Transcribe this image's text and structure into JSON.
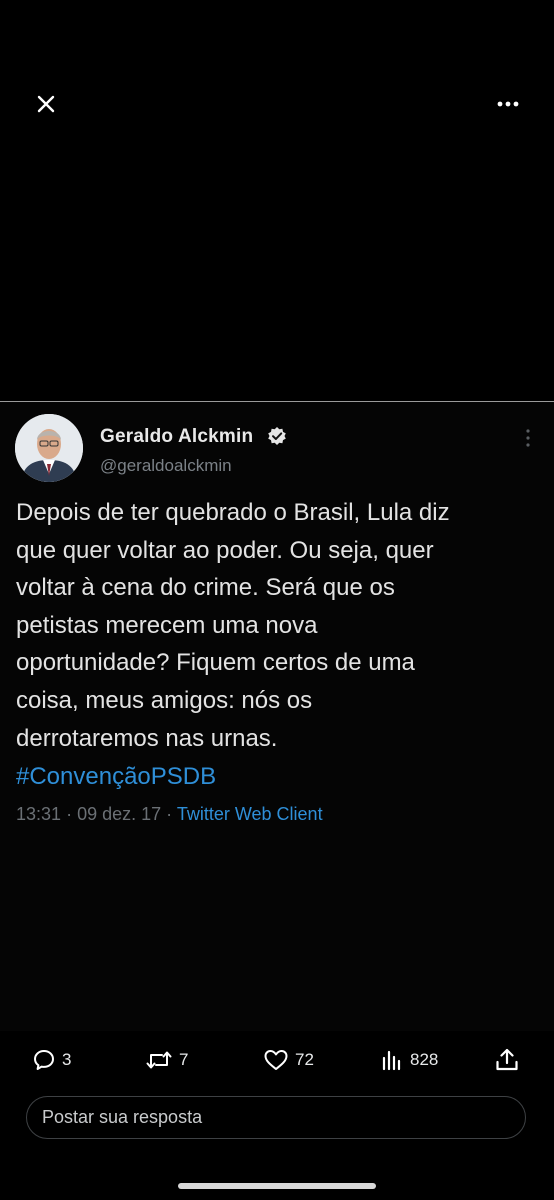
{
  "header": {
    "close_icon": "close-icon",
    "more_icon": "more-horizontal-icon"
  },
  "tweet": {
    "author_name": "Geraldo Alckmin",
    "author_handle": "@geraldoalckmin",
    "verified": true,
    "text_lines": [
      "Depois de ter quebrado o Brasil, Lula diz",
      "que quer voltar ao poder. Ou seja, quer",
      "voltar à cena do crime. Será que os",
      "petistas merecem uma nova",
      "oportunidade? Fiquem certos de uma",
      "coisa, meus amigos: nós os",
      "derrotaremos nas urnas."
    ],
    "hashtag": "#ConvençãoPSDB",
    "time": "13:31",
    "date": "09 dez. 17",
    "separator": "·",
    "client": "Twitter Web Client"
  },
  "actions": {
    "replies": "3",
    "retweets": "7",
    "likes": "72",
    "views": "828"
  },
  "reply": {
    "placeholder": "Postar sua resposta"
  },
  "colors": {
    "background": "#000000",
    "link": "#2f8fd8",
    "text": "#e7e9ea",
    "muted": "#6b7075"
  }
}
